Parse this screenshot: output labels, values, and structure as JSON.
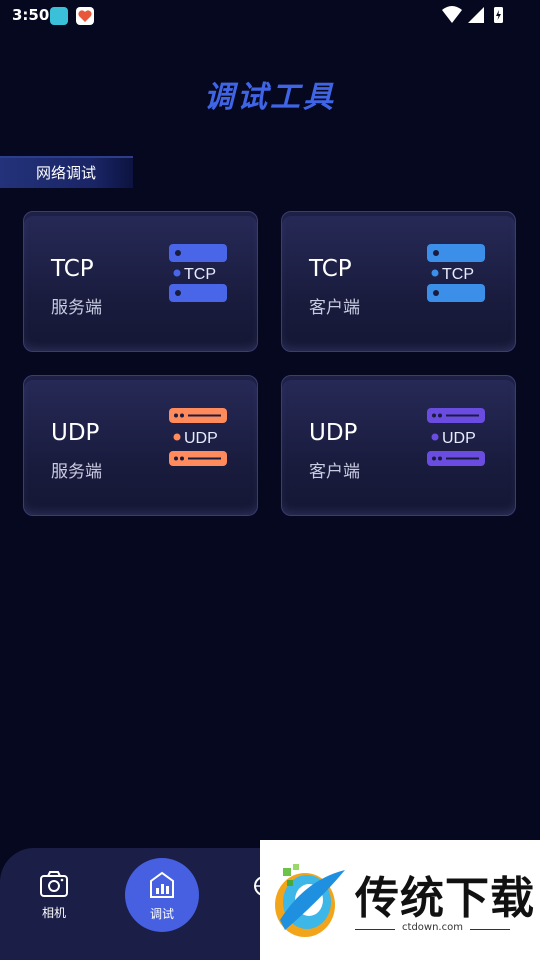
{
  "status_bar": {
    "time": "3:50",
    "icons": [
      "notification-app-icon",
      "notification-heart-icon",
      "wifi-icon",
      "signal-icon",
      "battery-charging-icon"
    ]
  },
  "title": "调试工具",
  "section": {
    "label": "网络调试"
  },
  "cards": [
    {
      "title": "TCP",
      "subtitle": "服务端",
      "icon_text": "TCP",
      "icon": "tcp-server-icon",
      "color": "#4a66e8"
    },
    {
      "title": "TCP",
      "subtitle": "客户端",
      "icon_text": "TCP",
      "icon": "tcp-client-icon",
      "color": "#3b8fe8"
    },
    {
      "title": "UDP",
      "subtitle": "服务端",
      "icon_text": "UDP",
      "icon": "udp-server-icon",
      "color": "#ff8a5c"
    },
    {
      "title": "UDP",
      "subtitle": "客户端",
      "icon_text": "UDP",
      "icon": "udp-client-icon",
      "color": "#6a4de0"
    }
  ],
  "nav": {
    "camera": {
      "label": "相机",
      "icon": "camera-icon"
    },
    "debug": {
      "label": "调试",
      "icon": "debug-tools-icon",
      "active": true
    },
    "third": {
      "icon": "globe-icon"
    }
  },
  "watermark": {
    "text": "传统下载",
    "url": "ctdown.com"
  },
  "colors": {
    "background": "#05081e",
    "accent": "#4660e1",
    "title": "#3f65e6"
  }
}
